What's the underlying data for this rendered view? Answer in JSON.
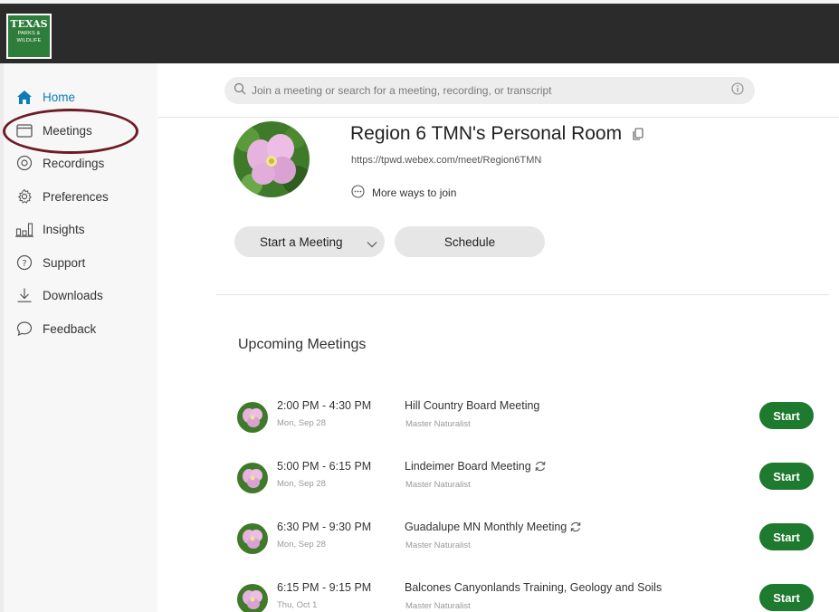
{
  "brand": {
    "logo_line1": "TEXAS",
    "logo_line2": "PARKS &",
    "logo_line3": "WILDLIFE"
  },
  "sidebar": {
    "items": [
      {
        "label": "Home",
        "icon": "home-icon",
        "active": true
      },
      {
        "label": "Meetings",
        "icon": "calendar-icon",
        "active": false
      },
      {
        "label": "Recordings",
        "icon": "record-icon",
        "active": false
      },
      {
        "label": "Preferences",
        "icon": "gear-icon",
        "active": false
      },
      {
        "label": "Insights",
        "icon": "bar-chart-icon",
        "active": false
      },
      {
        "label": "Support",
        "icon": "help-icon",
        "active": false
      },
      {
        "label": "Downloads",
        "icon": "download-icon",
        "active": false
      },
      {
        "label": "Feedback",
        "icon": "chat-bubble-icon",
        "active": false
      }
    ]
  },
  "search": {
    "placeholder": "Join a meeting or search for a meeting, recording, or transcript"
  },
  "room": {
    "title": "Region 6 TMN's Personal Room",
    "url": "https://tpwd.webex.com/meet/Region6TMN",
    "more_ways": "More ways to join"
  },
  "actions": {
    "start_meeting": "Start a Meeting",
    "schedule": "Schedule"
  },
  "upcoming": {
    "title": "Upcoming Meetings",
    "meetings": [
      {
        "time": "2:00 PM - 4:30 PM",
        "date": "Mon, Sep 28",
        "title": "Hill Country Board Meeting",
        "host": "Master Naturalist",
        "recurring": false,
        "action": "Start"
      },
      {
        "time": "5:00 PM - 6:15 PM",
        "date": "Mon, Sep 28",
        "title": "Lindeimer Board Meeting",
        "host": "Master Naturalist",
        "recurring": true,
        "action": "Start"
      },
      {
        "time": "6:30 PM - 9:30 PM",
        "date": "Mon, Sep 28",
        "title": "Guadalupe MN Monthly Meeting",
        "host": "Master Naturalist",
        "recurring": true,
        "action": "Start"
      },
      {
        "time": "6:15 PM - 9:15 PM",
        "date": "Thu, Oct 1",
        "title": "Balcones Canyonlands Training, Geology and Soils",
        "host": "Master Naturalist",
        "recurring": false,
        "action": "Start"
      }
    ]
  },
  "colors": {
    "accent": "#0a7cb8",
    "start_button": "#1e7a2e",
    "topbar": "#2b2b2b",
    "annotation": "#6d1c26"
  }
}
